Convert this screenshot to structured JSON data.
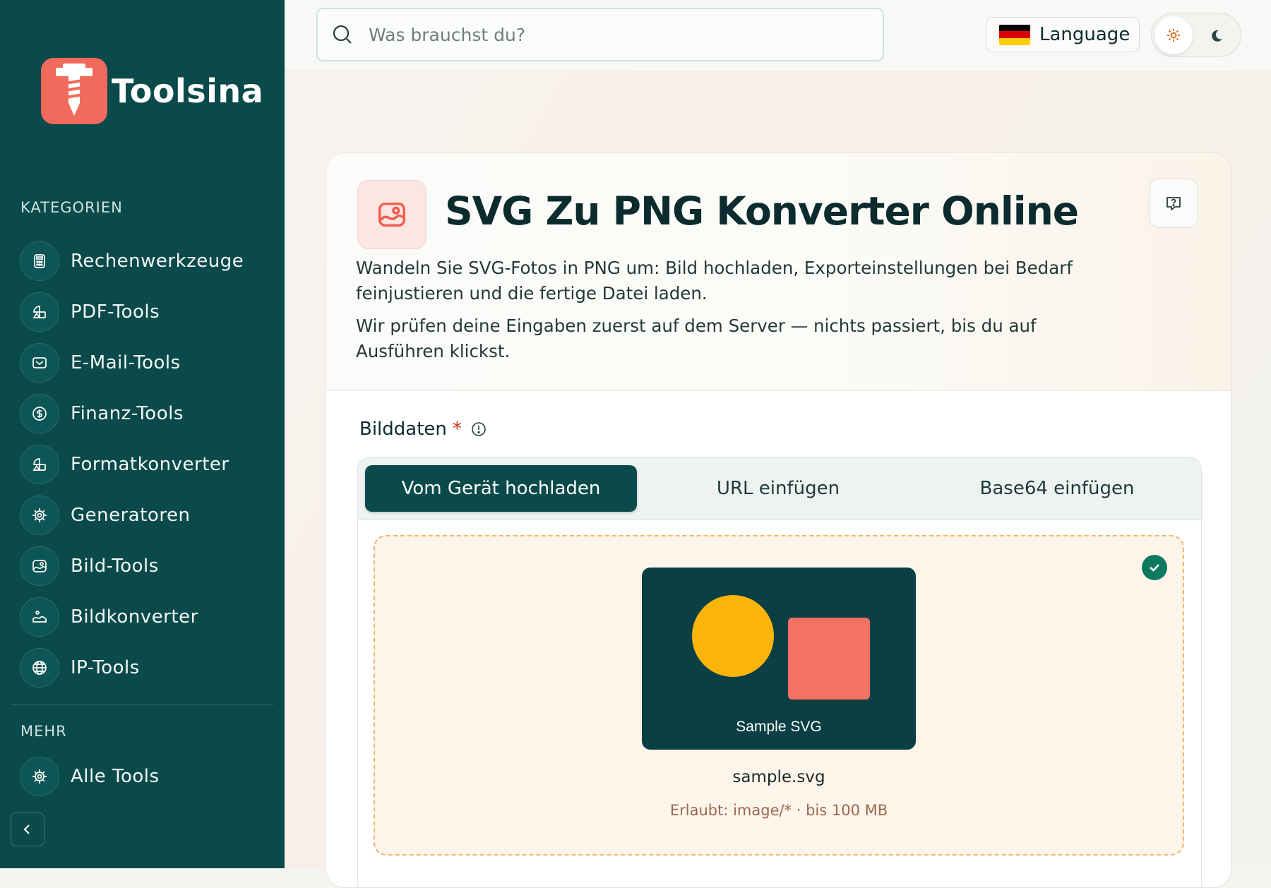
{
  "brand": {
    "name": "Toolsina"
  },
  "sidebar": {
    "categories_label": "KATEGORIEN",
    "items": [
      {
        "label": "Rechenwerkzeuge",
        "icon": "calculator-icon"
      },
      {
        "label": "PDF-Tools",
        "icon": "shapes-icon"
      },
      {
        "label": "E-Mail-Tools",
        "icon": "mail-icon"
      },
      {
        "label": "Finanz-Tools",
        "icon": "dollar-icon"
      },
      {
        "label": "Formatkonverter",
        "icon": "shapes-icon"
      },
      {
        "label": "Generatoren",
        "icon": "gear-icon"
      },
      {
        "label": "Bild-Tools",
        "icon": "image-icon"
      },
      {
        "label": "Bildkonverter",
        "icon": "image-convert-icon"
      },
      {
        "label": "IP-Tools",
        "icon": "globe-icon"
      }
    ],
    "more_label": "MEHR",
    "more_items": [
      {
        "label": "Alle Tools",
        "icon": "gear-icon"
      }
    ]
  },
  "topbar": {
    "search_placeholder": "Was brauchst du?",
    "language_label": "Language"
  },
  "tool": {
    "title": "SVG Zu PNG Konverter Online",
    "description_1": "Wandeln Sie SVG-Fotos in PNG um: Bild hochladen, Exporteinstellungen bei Bedarf feinjustieren und die fertige Datei laden.",
    "description_2": "Wir prüfen deine Eingaben zuerst auf dem Server — nichts passiert, bis du auf Ausführen klickst.",
    "field_label": "Bilddaten",
    "required_mark": "*",
    "tabs": [
      "Vom Gerät hochladen",
      "URL einfügen",
      "Base64 einfügen"
    ],
    "preview_caption": "Sample SVG",
    "filename": "sample.svg",
    "allowed": "Erlaubt: image/* · bis 100 MB"
  },
  "colors": {
    "sidebar_bg": "#0b4a4a",
    "accent": "#f26a5b",
    "preview_circle": "#fbb50a",
    "preview_square": "#f47263",
    "success": "#0d7a5f"
  }
}
